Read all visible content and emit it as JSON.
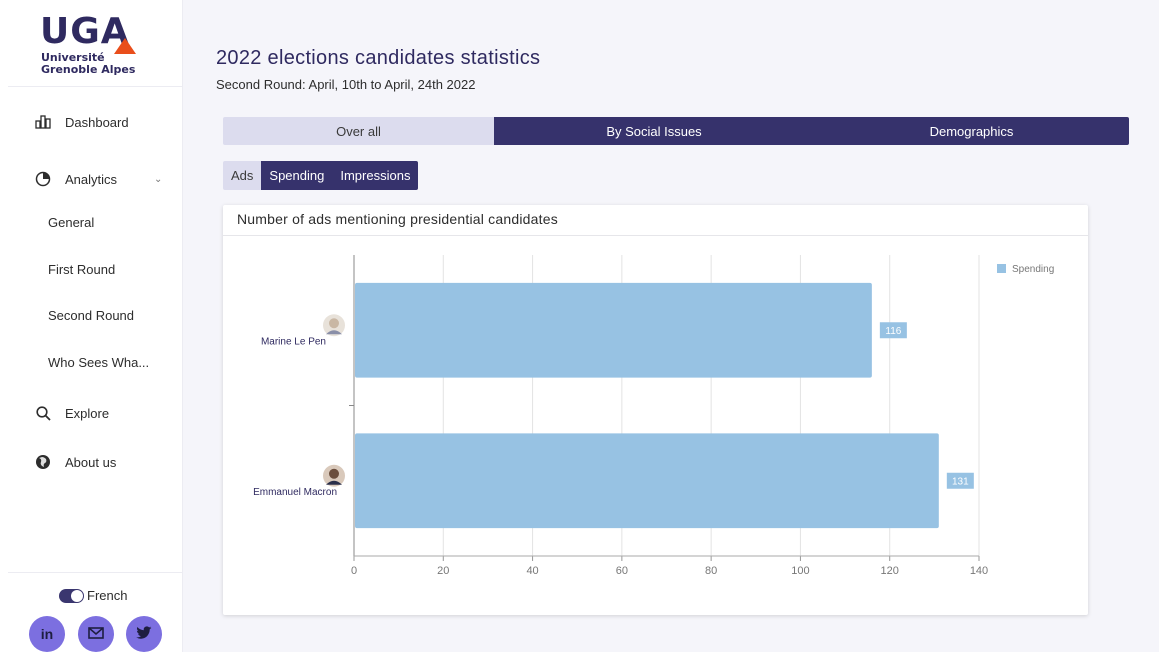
{
  "sidebar": {
    "logo": {
      "main": "UGA",
      "line1": "Université",
      "line2": "Grenoble Alpes"
    },
    "nav": [
      {
        "label": "Dashboard",
        "icon": "bar-chart-icon"
      },
      {
        "label": "Analytics",
        "icon": "pie-chart-icon"
      },
      {
        "label": "General"
      },
      {
        "label": "First Round"
      },
      {
        "label": "Second Round"
      },
      {
        "label": "Who Sees Wha..."
      },
      {
        "label": "Explore",
        "icon": "search-icon"
      },
      {
        "label": "About us",
        "icon": "globe-icon"
      }
    ],
    "language": "French",
    "social": [
      {
        "label": "in",
        "icon": "linkedin-icon"
      },
      {
        "label": "✉",
        "icon": "mail-icon"
      },
      {
        "label": "🐦",
        "icon": "twitter-icon"
      }
    ]
  },
  "main": {
    "title": "2022 elections candidates statistics",
    "subtitle": "Second Round: April, 10th to April, 24th 2022",
    "tabs": [
      {
        "label": "Over all",
        "active": true
      },
      {
        "label": "By Social Issues",
        "active": false
      },
      {
        "label": "Demographics",
        "active": false
      }
    ],
    "subtabs": [
      {
        "label": "Ads",
        "active": true
      },
      {
        "label": "Spending",
        "active": false
      },
      {
        "label": "Impressions",
        "active": false
      }
    ],
    "card_title": "Number of ads mentioning presidential candidates"
  },
  "colors": {
    "bar": "#97c2e3",
    "primary": "#36326c",
    "accent": "#e94e1b"
  },
  "chart_data": {
    "type": "bar",
    "orientation": "horizontal",
    "categories": [
      "Marine Le Pen",
      "Emmanuel Macron"
    ],
    "series": [
      {
        "name": "Spending",
        "values": [
          116,
          131
        ]
      }
    ],
    "xlim": [
      0,
      140
    ],
    "xticks": [
      0,
      20,
      40,
      60,
      80,
      100,
      120,
      140
    ],
    "grid": true,
    "legend": "top-right"
  }
}
